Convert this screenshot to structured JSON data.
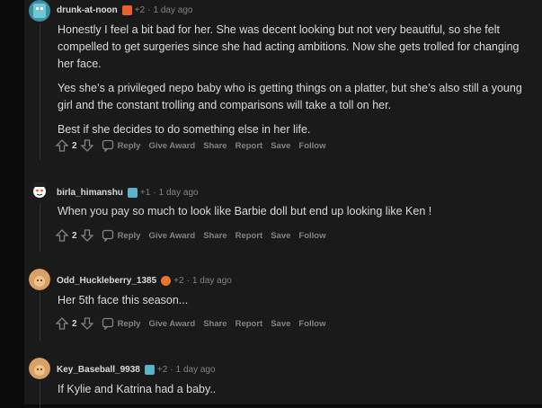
{
  "comments": [
    {
      "username": "drunk-at-noon",
      "flair_icon": "fire-flair-icon",
      "karma": "+2",
      "time": "1 day ago",
      "paragraphs": [
        "Honestly I feel a bit bad for her. She was decent looking but not very beautiful, so she felt compelled to get surgeries since she had acting ambitions. Now she gets trolled for changing her face.",
        "Yes she’s a privileged nepo baby who is getting things on a platter, but she’s also still a young girl and the constant trolling and comparisons will take a toll on her.",
        "Best if she decides to do something else in her life."
      ],
      "score": "2"
    },
    {
      "username": "birla_himanshu",
      "flair_icon": "cat-flair-icon",
      "karma": "+1",
      "time": "1 day ago",
      "paragraphs": [
        "When you pay so much to look like Barbie doll but end up looking like Ken !"
      ],
      "score": "2"
    },
    {
      "username": "Odd_Huckleberry_1385",
      "flair_icon": "orange-flair-icon",
      "karma": "+2",
      "time": "1 day ago",
      "paragraphs": [
        "Her 5th face this season..."
      ],
      "score": "2"
    },
    {
      "username": "Key_Baseball_9938",
      "flair_icon": "cat-flair-icon",
      "karma": "+2",
      "time": "1 day ago",
      "paragraphs": [
        "If Kylie and Katrina had a baby.."
      ]
    }
  ],
  "actions": {
    "reply": "Reply",
    "give_award": "Give Award",
    "share": "Share",
    "report": "Report",
    "save": "Save",
    "follow": "Follow"
  }
}
